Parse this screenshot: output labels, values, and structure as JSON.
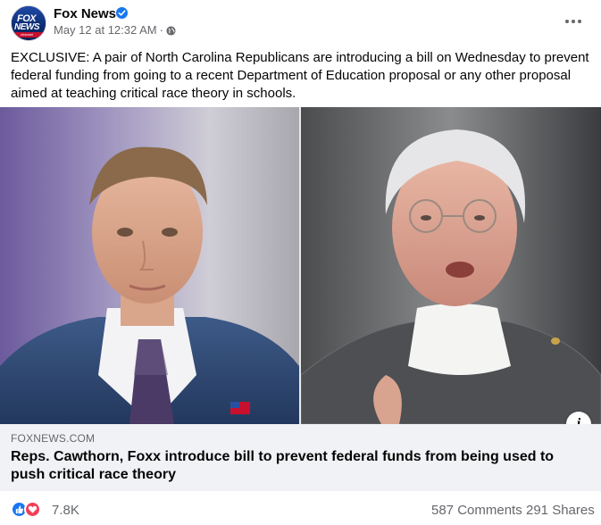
{
  "post": {
    "page_name": "Fox News",
    "avatar_text_top": "FOX",
    "avatar_text_mid": "NEWS",
    "avatar_text_channel": "channel",
    "timestamp": "May 12 at 12:32 AM",
    "separator": "·",
    "caption": "EXCLUSIVE: A pair of North Carolina Republicans are introducing a bill on Wednesday to prevent federal funding from going to a recent Department of Education proposal or any other proposal aimed at teaching critical race theory in schools."
  },
  "link": {
    "domain": "FOXNEWS.COM",
    "title": "Reps. Cawthorn, Foxx introduce bill to prevent federal funds from being used to push critical race theory",
    "info_label": "i"
  },
  "footer": {
    "reaction_count": "7.8K",
    "comments": "587 Comments",
    "shares": "291 Shares"
  },
  "icons": {
    "verified": "verified-badge-icon",
    "globe": "globe-icon",
    "more": "more-options-icon",
    "like": "like-reaction-icon",
    "love": "love-reaction-icon",
    "info": "info-icon"
  },
  "colors": {
    "brand_blue": "#1877f2",
    "love_red": "#f33e58",
    "secondary_text": "#65676b",
    "link_background": "#f0f2f5"
  }
}
